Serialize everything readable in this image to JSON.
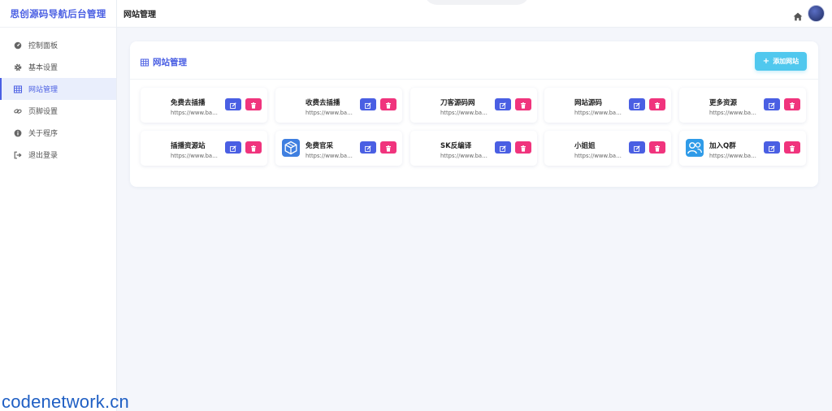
{
  "brand": "思创源码导航后台管理",
  "sidebar": {
    "items": [
      {
        "label": "控制面板",
        "icon": "dashboard-icon"
      },
      {
        "label": "基本设置",
        "icon": "gear-icon"
      },
      {
        "label": "网站管理",
        "icon": "grid-icon",
        "active": true
      },
      {
        "label": "页脚设置",
        "icon": "link-icon"
      },
      {
        "label": "关于程序",
        "icon": "info-icon"
      },
      {
        "label": "退出登录",
        "icon": "logout-icon"
      }
    ]
  },
  "topbar": {
    "title": "网站管理",
    "home_icon": "home-icon",
    "avatar": "user-avatar"
  },
  "panel": {
    "title": "网站管理",
    "title_icon": "grid-icon",
    "add_label": "添加网站"
  },
  "sites": [
    {
      "name": "免费去插播",
      "url": "https://www.baidu.com",
      "logo": ""
    },
    {
      "name": "收费去插播",
      "url": "https://www.baidu.com",
      "logo": ""
    },
    {
      "name": "刀客源码网",
      "url": "https://www.baidu.com",
      "logo": ""
    },
    {
      "name": "网站源码",
      "url": "https://www.baidu.com",
      "logo": ""
    },
    {
      "name": "更多资源",
      "url": "https://www.baidu.com",
      "logo": ""
    },
    {
      "name": "插播资源站",
      "url": "https://www.baidu.com",
      "logo": ""
    },
    {
      "name": "免费官采",
      "url": "https://www.baidu.com",
      "logo": "box-logo-icon"
    },
    {
      "name": "SK反编译",
      "url": "https://www.baidu.com",
      "logo": ""
    },
    {
      "name": "小姐姐",
      "url": "https://www.baidu.com",
      "logo": ""
    },
    {
      "name": "加入Q群",
      "url": "https://www.baidu.com",
      "logo": "group-logo-icon"
    }
  ],
  "colors": {
    "primary": "#4a5fe3",
    "add": "#50c8ee",
    "delete": "#f0347d"
  },
  "watermark": "codenetwork.cn"
}
